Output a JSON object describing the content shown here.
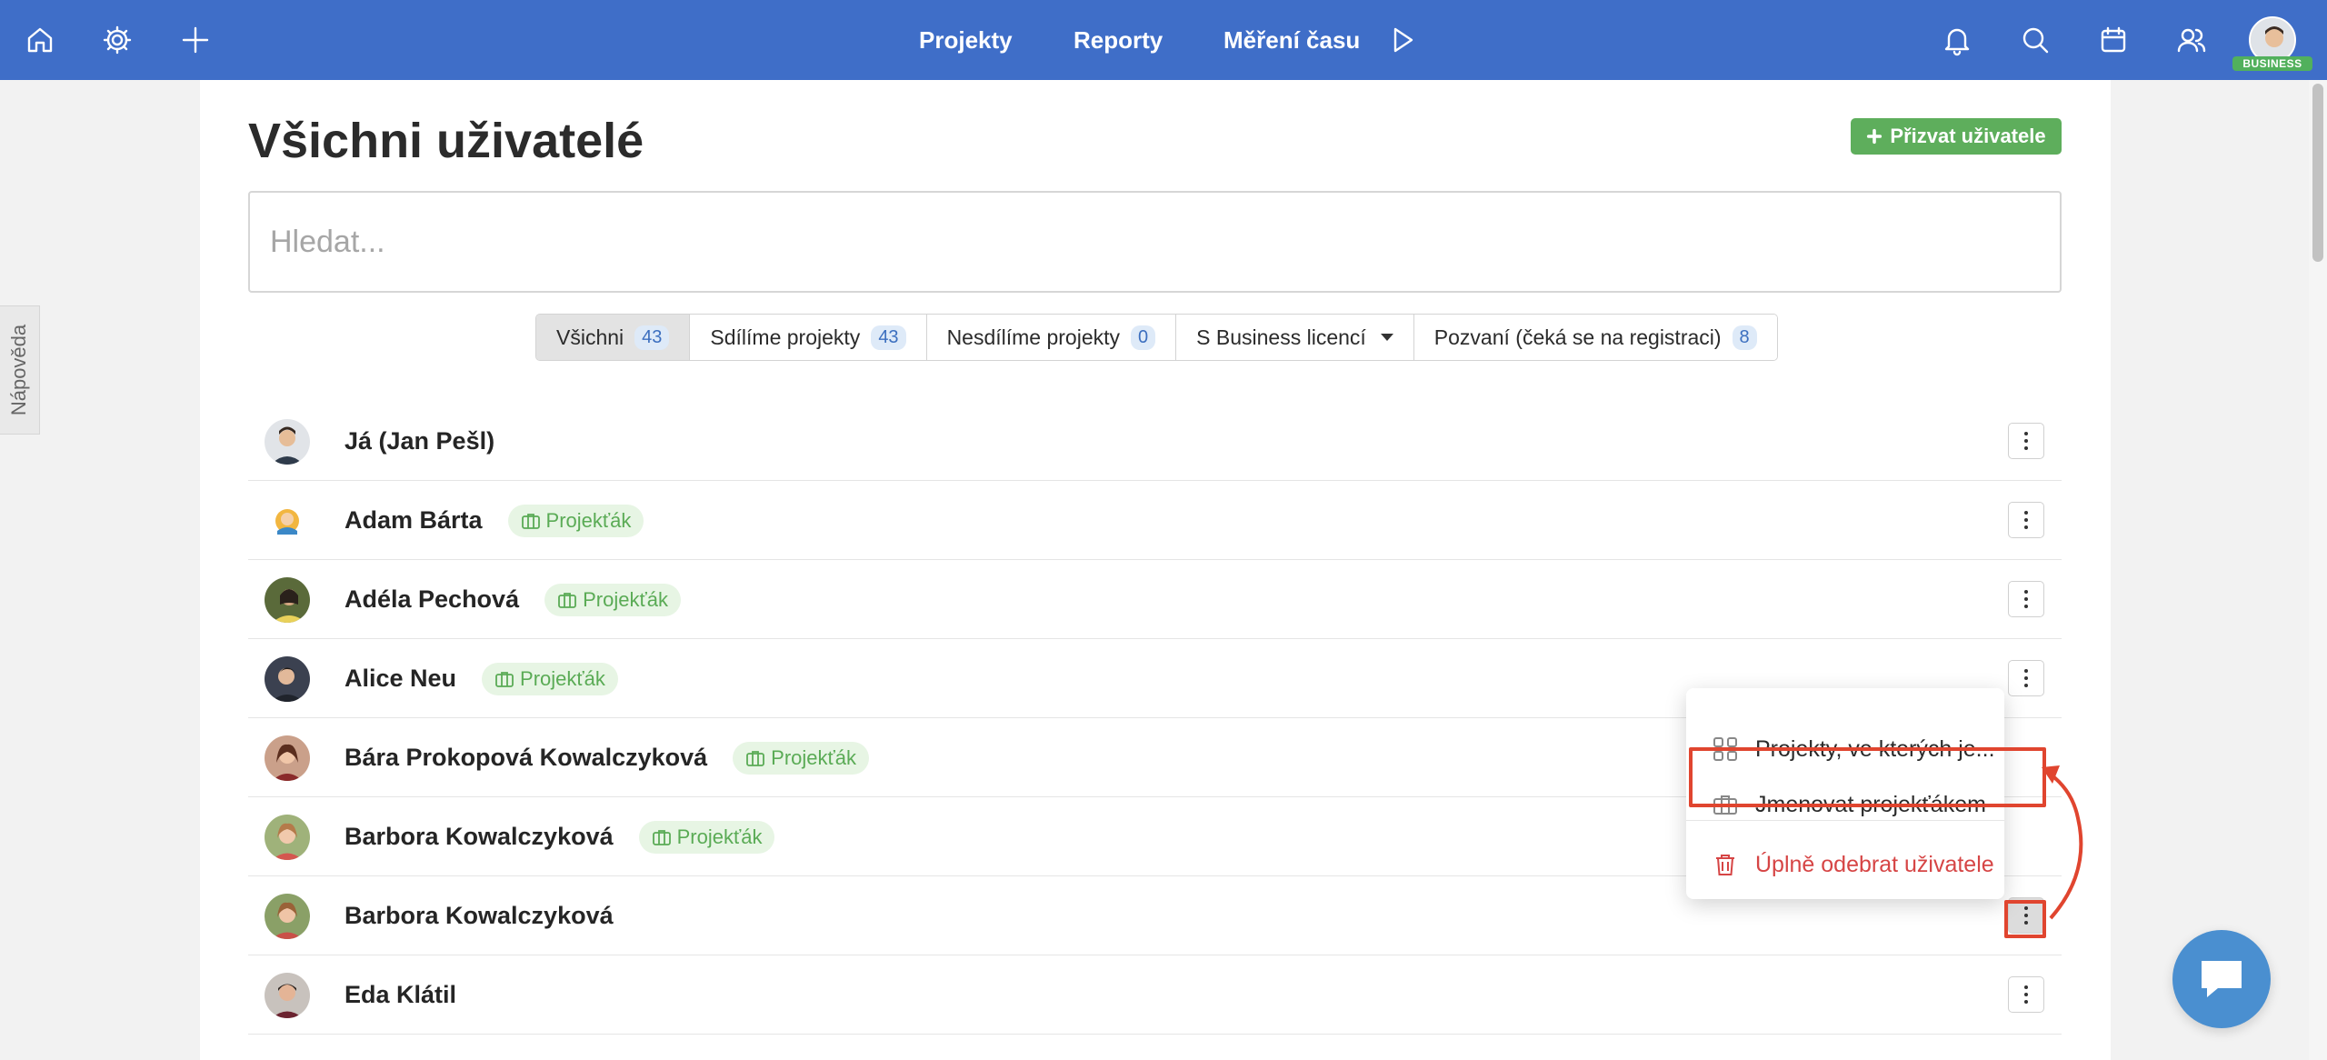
{
  "topbar": {
    "nav": [
      "Projekty",
      "Reporty",
      "Měření času"
    ],
    "badge": "BUSINESS"
  },
  "help_tab": "Nápověda",
  "page": {
    "title": "Všichni uživatelé",
    "invite_label": "Přizvat uživatele",
    "search_placeholder": "Hledat..."
  },
  "filters": [
    {
      "label": "Všichni",
      "count": "43"
    },
    {
      "label": "Sdílíme projekty",
      "count": "43"
    },
    {
      "label": "Nesdílíme projekty",
      "count": "0"
    },
    {
      "label": "S Business licencí"
    },
    {
      "label": "Pozvaní (čeká se na registraci)",
      "count": "8"
    }
  ],
  "users": [
    {
      "name": "Já (Jan Pešl)"
    },
    {
      "name": "Adam Bárta",
      "tag": "Projekťák"
    },
    {
      "name": "Adéla Pechová",
      "tag": "Projekťák"
    },
    {
      "name": "Alice Neu",
      "tag": "Projekťák"
    },
    {
      "name": "Bára Prokopová Kowalczyková",
      "tag": "Projekťák"
    },
    {
      "name": "Barbora Kowalczyková",
      "tag": "Projekťák"
    },
    {
      "name": "Barbora Kowalczyková"
    },
    {
      "name": "Eda Klátil"
    }
  ],
  "menu": {
    "projects": "Projekty, ve kterých je...",
    "make_pm": "Jmenovat projekťákem",
    "remove": "Úplně odebrat uživatele"
  },
  "colors": {
    "topbar": "#3f6ec8",
    "accent_green": "#5eae5c",
    "highlight_red": "#e0452f",
    "danger": "#d64545"
  }
}
